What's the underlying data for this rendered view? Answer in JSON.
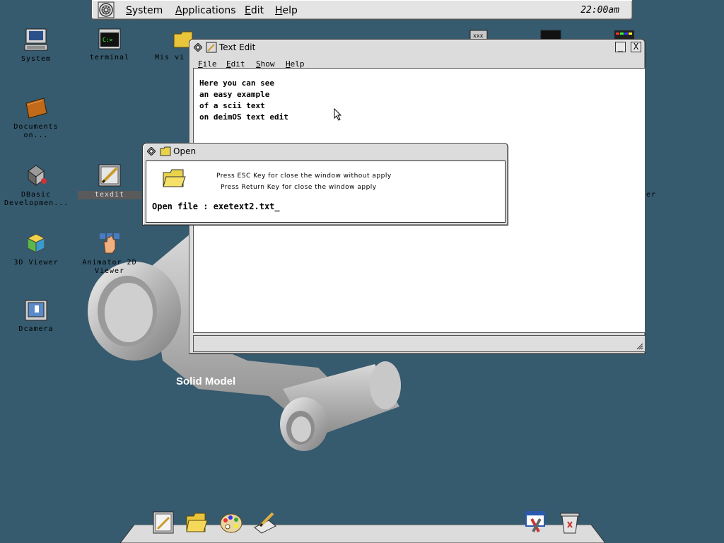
{
  "menubar": {
    "items": [
      "System",
      "Applications",
      "Edit",
      "Help"
    ],
    "clock": "22:00am"
  },
  "desktop_icons": [
    {
      "name": "system",
      "label": "System"
    },
    {
      "name": "terminal",
      "label": "terminal"
    },
    {
      "name": "mis-videos",
      "label": "Mis vi"
    },
    {
      "name": "documents",
      "label": "Documents\non..."
    },
    {
      "name": "dbasic",
      "label": "DBasic\nDevelopmen..."
    },
    {
      "name": "texdit",
      "label": "texdit"
    },
    {
      "name": "viewer-3d",
      "label": "3D Viewer"
    },
    {
      "name": "animator-2d",
      "label": "Animator 2D\nViewer"
    },
    {
      "name": "dcamera",
      "label": "Dcamera"
    }
  ],
  "partial_labels": {
    "right_er": "er"
  },
  "wallpaper": {
    "label": "Solid Model"
  },
  "text_edit": {
    "title": "Text Edit",
    "menu": [
      "File",
      "Edit",
      "Show",
      "Help"
    ],
    "lines": [
      "Here you can see",
      "an easy example",
      "of a scii text",
      "on deimOS text edit"
    ],
    "minimize": "_",
    "close": "X"
  },
  "open_dialog": {
    "title": "Open",
    "hint_esc": "Press ESC Key for close the window without apply",
    "hint_return": "Press Return Key for close the window apply",
    "prompt": "Open file : exetext2.txt_"
  },
  "dock": {
    "items": [
      "notepad-icon",
      "folder-icon",
      "paint-palette-icon",
      "pen-tablet-icon",
      "settings-icon",
      "trash-icon"
    ]
  },
  "colors": {
    "desktop": "#365a6e",
    "window": "#dcdcdc"
  }
}
